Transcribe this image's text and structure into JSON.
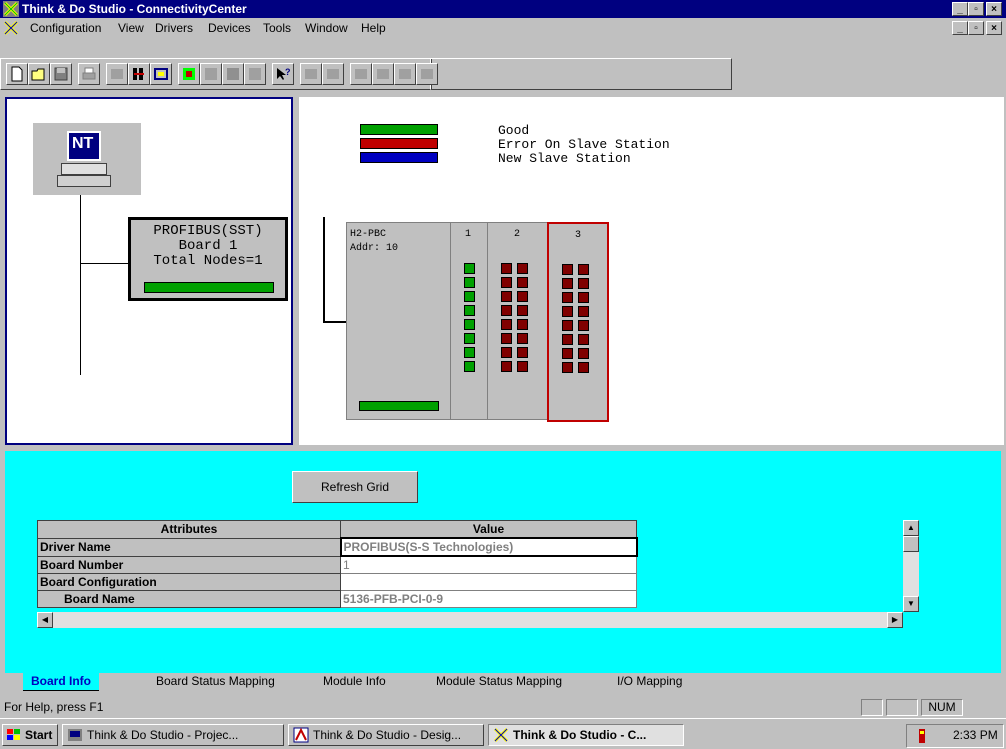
{
  "window": {
    "title": "Think & Do Studio - ConnectivityCenter"
  },
  "menu": {
    "items": [
      "Configuration",
      "View",
      "Drivers",
      "Devices",
      "Tools",
      "Window",
      "Help"
    ]
  },
  "tree": {
    "computer_label": "NT",
    "board_line1": "PROFIBUS(SST)",
    "board_line2": "Board 1",
    "board_line3": "Total Nodes=1"
  },
  "legend": {
    "good": "Good",
    "error": "Error On Slave Station",
    "new": "New Slave Station"
  },
  "rack": {
    "head_line1": "H2-PBC",
    "head_line2": "Addr: 10",
    "slots": [
      "1",
      "2",
      "3"
    ]
  },
  "refresh_button": "Refresh Grid",
  "grid": {
    "headers": [
      "Attributes",
      "Value"
    ],
    "rows": [
      {
        "attr": "Driver Name",
        "value": "PROFIBUS(S-S Technologies)"
      },
      {
        "attr": "Board Number",
        "value": "1"
      },
      {
        "attr": "Board Configuration",
        "value": ""
      },
      {
        "attr": "Board Name",
        "value": "5136-PFB-PCI-0-9"
      }
    ]
  },
  "tabs": [
    "Board Info",
    "Board Status Mapping",
    "Module Info",
    "Module Status Mapping",
    "I/O Mapping"
  ],
  "status": {
    "help": "For Help, press F1",
    "num": "NUM"
  },
  "taskbar": {
    "start": "Start",
    "tasks": [
      "Think & Do Studio - Projec...",
      "Think & Do Studio - Desig...",
      "Think & Do Studio - C..."
    ],
    "clock": "2:33 PM"
  },
  "colors": {
    "good": "#00a000",
    "error": "#c00000",
    "new": "#0000c0",
    "titlebar": "#000080",
    "bottom_bg": "#00ffff"
  }
}
